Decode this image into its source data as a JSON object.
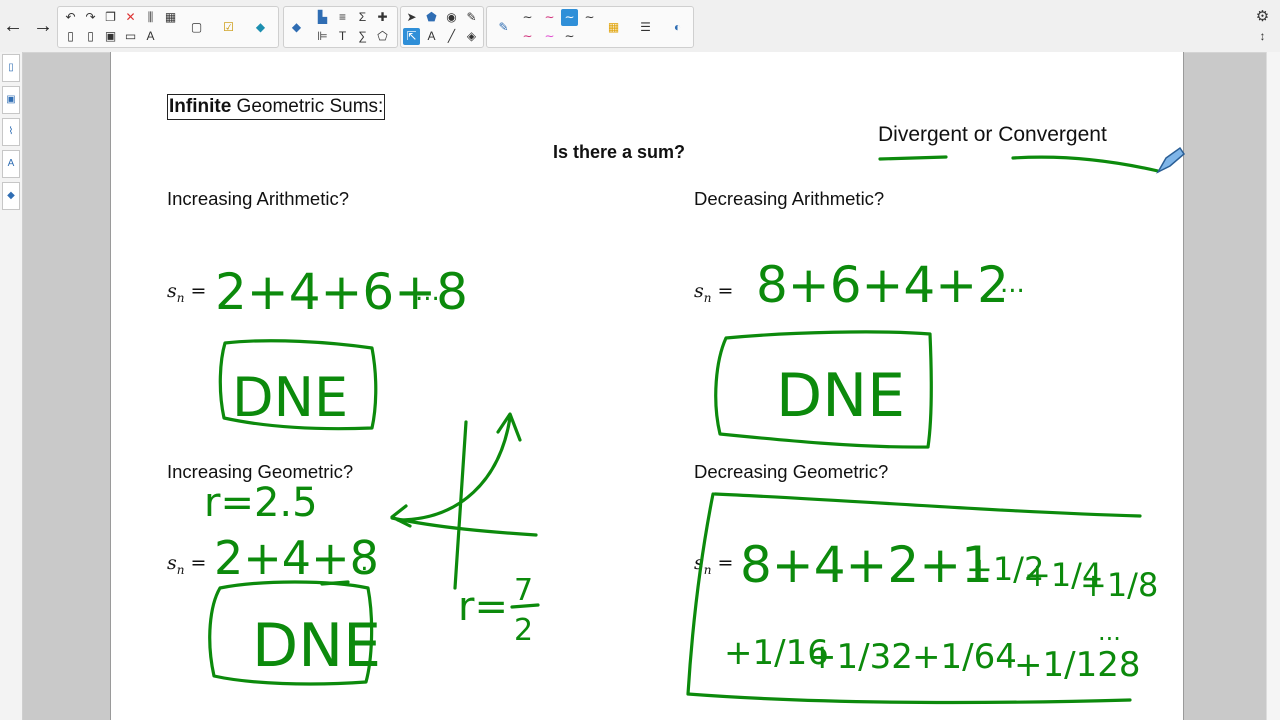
{
  "toolbar": {
    "undo": "↶",
    "redo": "↷",
    "back": "←",
    "forward": "→",
    "delete": "✕",
    "text_tool": "A",
    "sigma": "Σ",
    "settings": "⚙"
  },
  "page": {
    "title_bold": "Infinite",
    "title_rest": " Geometric Sums:",
    "question": "Is there a sum?",
    "classify": "Divergent or Convergent",
    "sections": {
      "inc_arith": "Increasing Arithmetic?",
      "dec_arith": "Decreasing Arithmetic?",
      "inc_geom": "Increasing Geometric?",
      "dec_geom": "Decreasing Geometric?"
    },
    "sn_label": "s",
    "sn_sub": "n",
    "eq": "="
  },
  "ink": {
    "color": "#0c8a0c",
    "inc_arith_series": "2+4+6+8",
    "dec_arith_series": "8+6+4+2",
    "inc_geom_series": "2+4+8",
    "dec_geom_series": "8+4+2+1",
    "dne": "DNE",
    "ratio_inc": "r=2.5",
    "ratio_r": "r=",
    "ratio_num": "7",
    "ratio_den": "2",
    "dots": "...",
    "fracs": [
      "+1/2",
      "+1/4",
      "+1/8",
      "+1/16",
      "+1/32",
      "+1/64",
      "+1/128"
    ]
  }
}
